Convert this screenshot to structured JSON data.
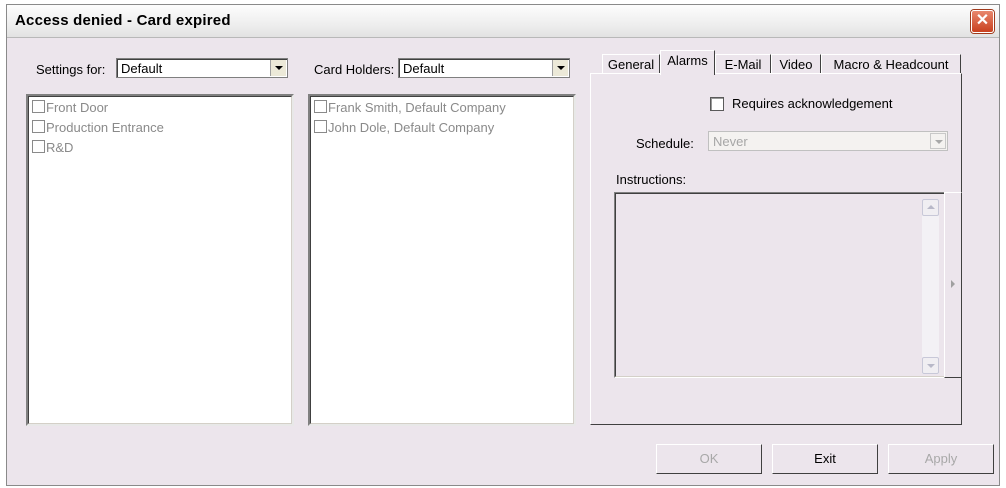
{
  "window": {
    "title": "Access denied - Card expired",
    "close_label": "✕"
  },
  "settings": {
    "label": "Settings for:",
    "value": "Default",
    "items": [
      "Front Door",
      "Production Entrance",
      "R&D"
    ]
  },
  "card_holders": {
    "label": "Card Holders:",
    "value": "Default",
    "items": [
      "Frank Smith, Default Company",
      "John Dole, Default Company"
    ]
  },
  "tabs": [
    "General",
    "Alarms",
    "E-Mail",
    "Video",
    "Macro & Headcount"
  ],
  "active_tab": "Alarms",
  "alarms": {
    "requires_ack_label": "Requires acknowledgement",
    "requires_ack_checked": false,
    "schedule_label": "Schedule:",
    "schedule_value": "Never",
    "instructions_label": "Instructions:",
    "instructions_value": ""
  },
  "buttons": {
    "ok": "OK",
    "exit": "Exit",
    "apply": "Apply"
  }
}
